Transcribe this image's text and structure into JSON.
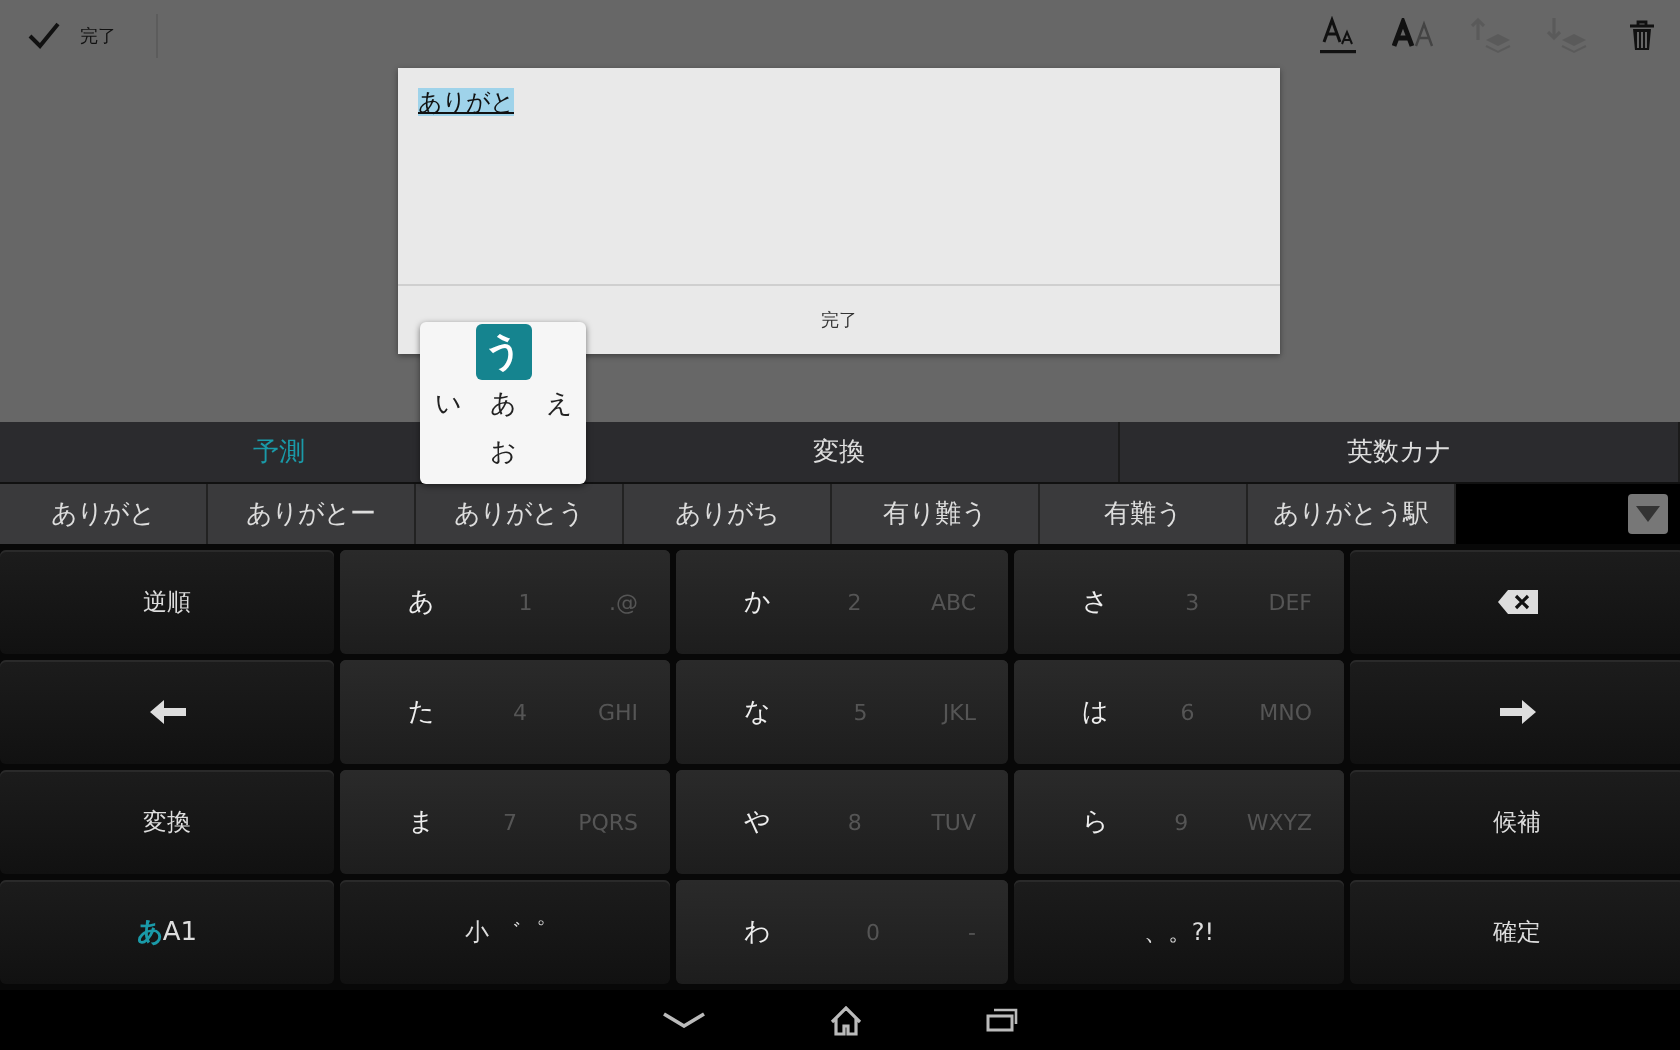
{
  "toolbar": {
    "done_label": "完了",
    "tools": [
      {
        "kind": "text-style",
        "disabled": false
      },
      {
        "kind": "text-size",
        "disabled": false
      },
      {
        "kind": "layer-up",
        "disabled": true
      },
      {
        "kind": "layer-down",
        "disabled": true
      },
      {
        "kind": "trash",
        "disabled": false
      }
    ]
  },
  "dialog": {
    "value": "ありがと",
    "button": "完了"
  },
  "tabs": [
    {
      "label": "予測",
      "selected": true
    },
    {
      "label": "変換",
      "selected": false
    },
    {
      "label": "英数カナ",
      "selected": false
    }
  ],
  "candidates": [
    "ありがと",
    "ありがとー",
    "ありがとう",
    "ありがち",
    "有り難う",
    "有難う",
    "ありがとう駅"
  ],
  "flick_popup": {
    "top": "う",
    "left": "い",
    "center": "あ",
    "right": "え",
    "bottom": "お"
  },
  "keys": [
    {
      "kind": "label",
      "label": "逆順"
    },
    {
      "kind": "kana",
      "main": "あ",
      "digit": "1",
      "letters": ".@"
    },
    {
      "kind": "kana",
      "main": "か",
      "digit": "2",
      "letters": "ABC"
    },
    {
      "kind": "kana",
      "main": "さ",
      "digit": "3",
      "letters": "DEF"
    },
    {
      "kind": "backspace"
    },
    {
      "kind": "left"
    },
    {
      "kind": "kana",
      "main": "た",
      "digit": "4",
      "letters": "GHI"
    },
    {
      "kind": "kana",
      "main": "な",
      "digit": "5",
      "letters": "JKL"
    },
    {
      "kind": "kana",
      "main": "は",
      "digit": "6",
      "letters": "MNO"
    },
    {
      "kind": "right"
    },
    {
      "kind": "label",
      "label": "変換"
    },
    {
      "kind": "kana",
      "main": "ま",
      "digit": "7",
      "letters": "PQRS"
    },
    {
      "kind": "kana",
      "main": "や",
      "digit": "8",
      "letters": "TUV"
    },
    {
      "kind": "kana",
      "main": "ら",
      "digit": "9",
      "letters": "WXYZ"
    },
    {
      "kind": "label",
      "label": "候補"
    },
    {
      "kind": "mode",
      "main": "あ",
      "sub": "A1"
    },
    {
      "kind": "label",
      "label": "小 ゛゜"
    },
    {
      "kind": "kana",
      "main": "わ",
      "digit": "0",
      "letters": "-"
    },
    {
      "kind": "label",
      "label": "、。?!"
    },
    {
      "kind": "label",
      "label": "確定"
    }
  ]
}
